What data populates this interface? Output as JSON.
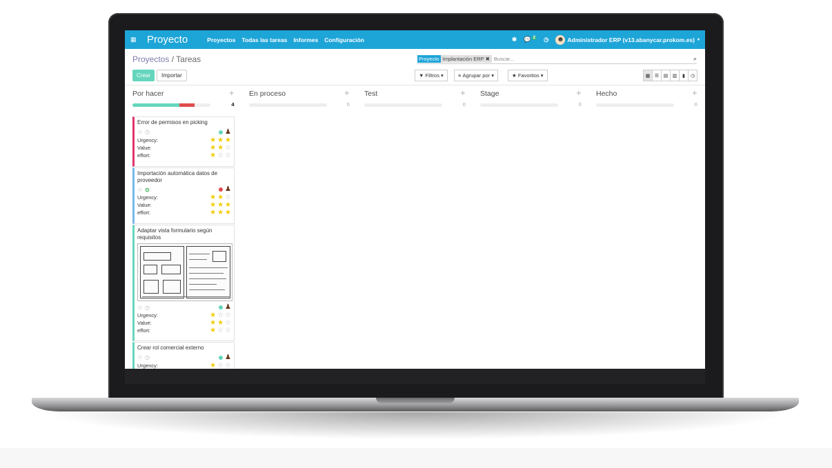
{
  "navbar": {
    "apps_icon": "apps-grid-icon",
    "brand": "Proyecto",
    "menu": [
      "Proyectos",
      "Todas las tareas",
      "Informes",
      "Configuración"
    ],
    "chat_badge": "2",
    "user": "Administrador ERP (v13.abanycar.prokom.es)"
  },
  "control_panel": {
    "breadcrumb_parent": "Proyectos",
    "breadcrumb_sep": " / ",
    "breadcrumb_current": "Tareas",
    "create_label": "Crear",
    "import_label": "Importar",
    "search": {
      "facet_category": "Proyecto",
      "facet_value": "Implantación ERP",
      "placeholder": "Buscar..."
    },
    "filters_label": "Filtros",
    "group_by_label": "Agrupar por",
    "favorites_label": "Favoritos",
    "views": [
      "kanban",
      "list",
      "calendar",
      "pivot",
      "graph",
      "activity"
    ]
  },
  "columns": [
    {
      "title": "Por hacer",
      "count": "4",
      "progress": {
        "green": 0.6,
        "red": 0.2
      }
    },
    {
      "title": "En proceso",
      "count": "0"
    },
    {
      "title": "Test",
      "count": "0"
    },
    {
      "title": "Stage",
      "count": "0"
    },
    {
      "title": "Hecho",
      "count": "0"
    }
  ],
  "cards": [
    {
      "title": "Error de permisos en picking",
      "border_color": "#e0336a",
      "status_color": "#65d6bd",
      "deadline_ok": false,
      "labels": [
        "Urgency:",
        "Value:",
        "effort:"
      ],
      "ratings": [
        3,
        2,
        1
      ]
    },
    {
      "title": "Importación automática datos de proveedor",
      "border_color": "#76b7ea",
      "status_color": "#e04b4b",
      "deadline_ok": true,
      "labels": [
        "Urgency:",
        "Value:",
        "effort:"
      ],
      "ratings": [
        2,
        3,
        3
      ]
    },
    {
      "title": "Adaptar vista formulario según requisitos",
      "border_color": "#65d6bd",
      "status_color": "#65d6bd",
      "deadline_ok": false,
      "has_image": true,
      "labels": [
        "Urgency:",
        "Value:",
        "effort:"
      ],
      "ratings": [
        1,
        2,
        1
      ]
    },
    {
      "title": "Crear rol comercial externo",
      "border_color": "#65d6bd",
      "status_color": "#65d6bd",
      "deadline_ok": false,
      "labels": [
        "Urgency:"
      ],
      "ratings": [
        1
      ]
    }
  ]
}
